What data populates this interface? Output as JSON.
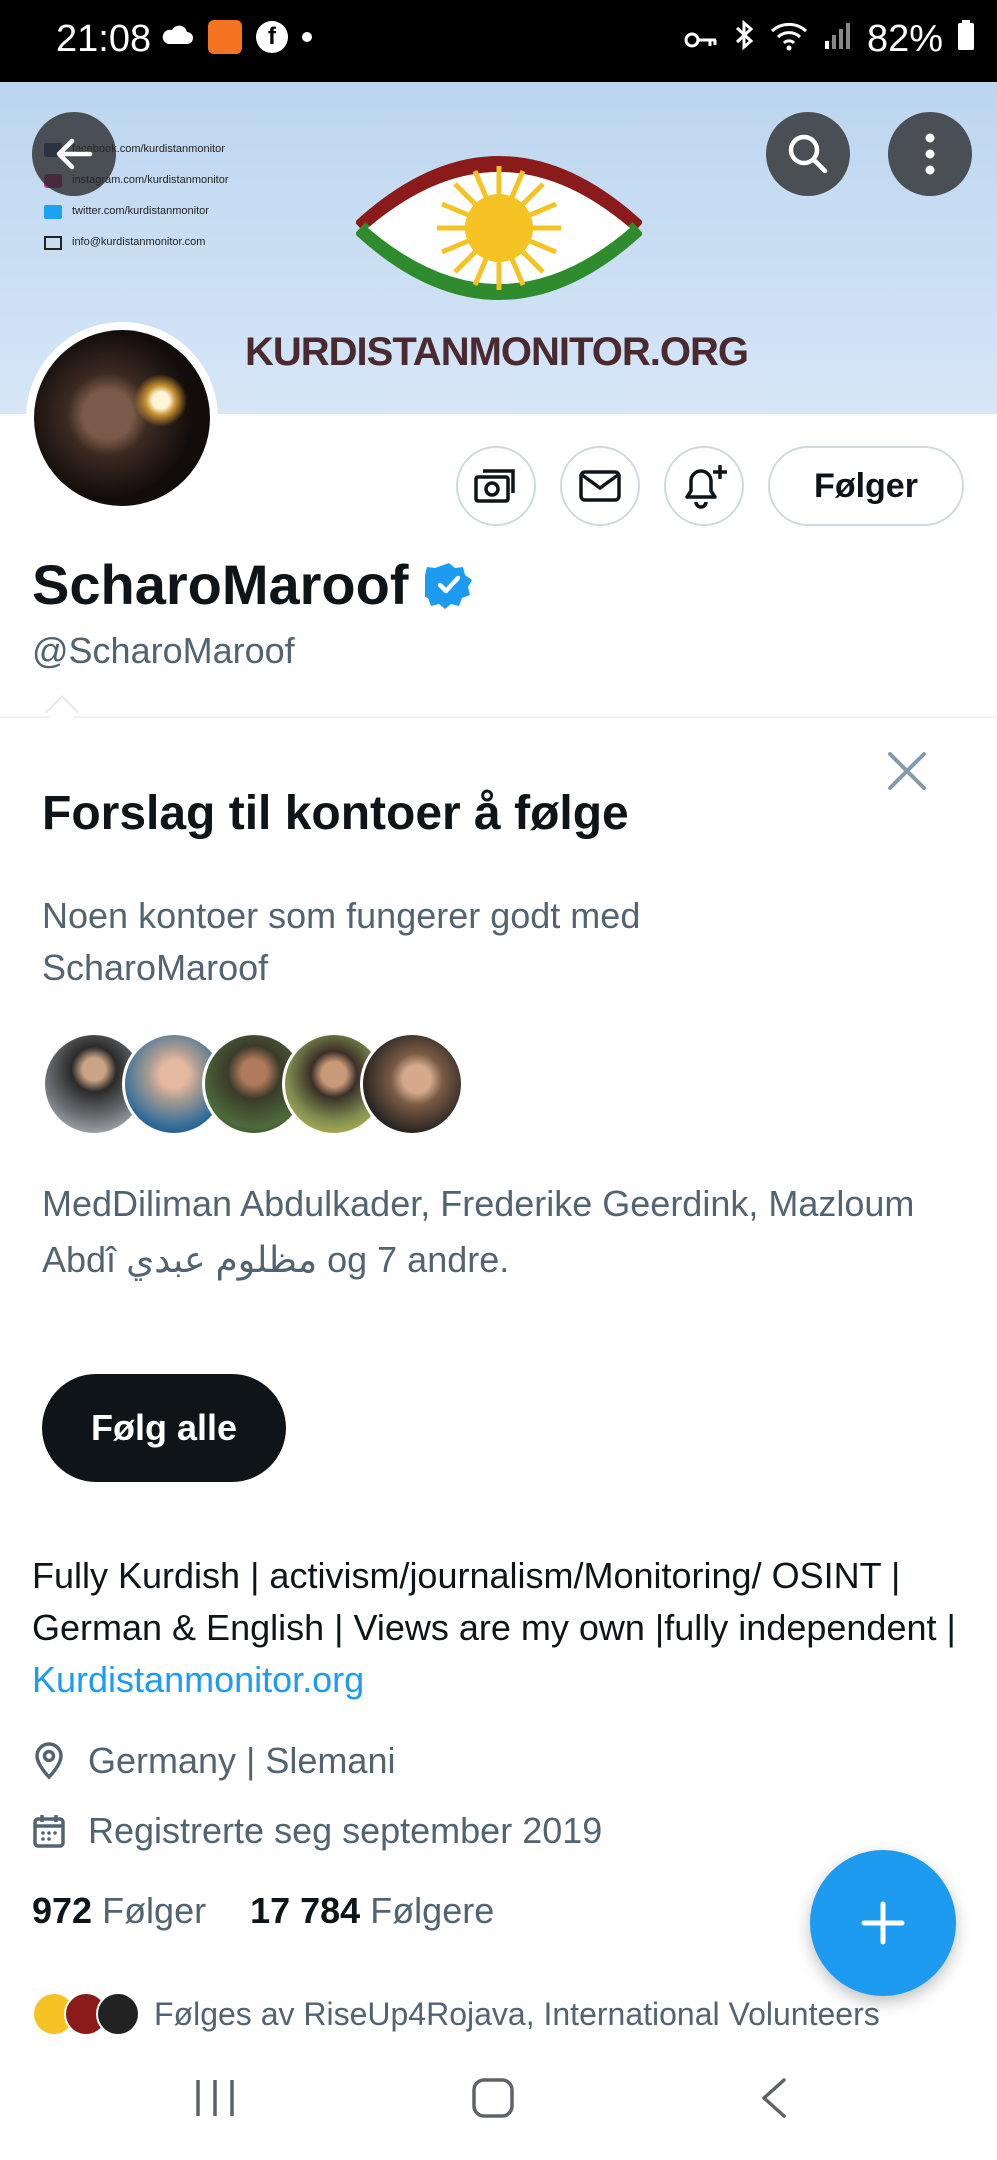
{
  "status_bar": {
    "time": "21:08",
    "battery": "82%"
  },
  "banner": {
    "contacts": [
      "facebook.com/kurdistanmonitor",
      "instagram.com/kurdistanmonitor",
      "twitter.com/kurdistanmonitor",
      "info@kurdistanmonitor.com"
    ],
    "brand": "KURDISTANMONITOR.ORG"
  },
  "profile": {
    "follow_button": "Følger",
    "name": "ScharoMaroof",
    "handle": "@ScharoMaroof",
    "bio_text": "Fully Kurdish | activism/journalism/Monitoring/ OSINT | German & English | Views are my own |fully independent | ",
    "bio_link": "Kurdistanmonitor.org",
    "location": "Germany | Slemani",
    "joined": "Registrerte seg september 2019",
    "following_count": "972",
    "following_label": "Følger",
    "followers_count": "17 784",
    "followers_label": "Følgere",
    "followed_by": "Følges av RiseUp4Rojava, International Volunteers"
  },
  "suggestions": {
    "title": "Forslag til kontoer å følge",
    "subtitle": "Noen kontoer som fungerer godt med ScharoMaroof",
    "names": "MedDiliman Abdulkader, Frederike Geerdink, Mazloum Abdî مظلوم عبدي og 7 andre.",
    "follow_all": "Følg alle"
  },
  "colors": {
    "accent": "#1d9bf0",
    "text": "#0f1419",
    "secondary": "#536471"
  },
  "icons": [
    "back-arrow-icon",
    "search-icon",
    "more-icon",
    "tip-icon",
    "mail-icon",
    "bell-plus-icon",
    "verified-icon",
    "close-icon",
    "location-icon",
    "calendar-icon",
    "compose-plus-icon"
  ]
}
